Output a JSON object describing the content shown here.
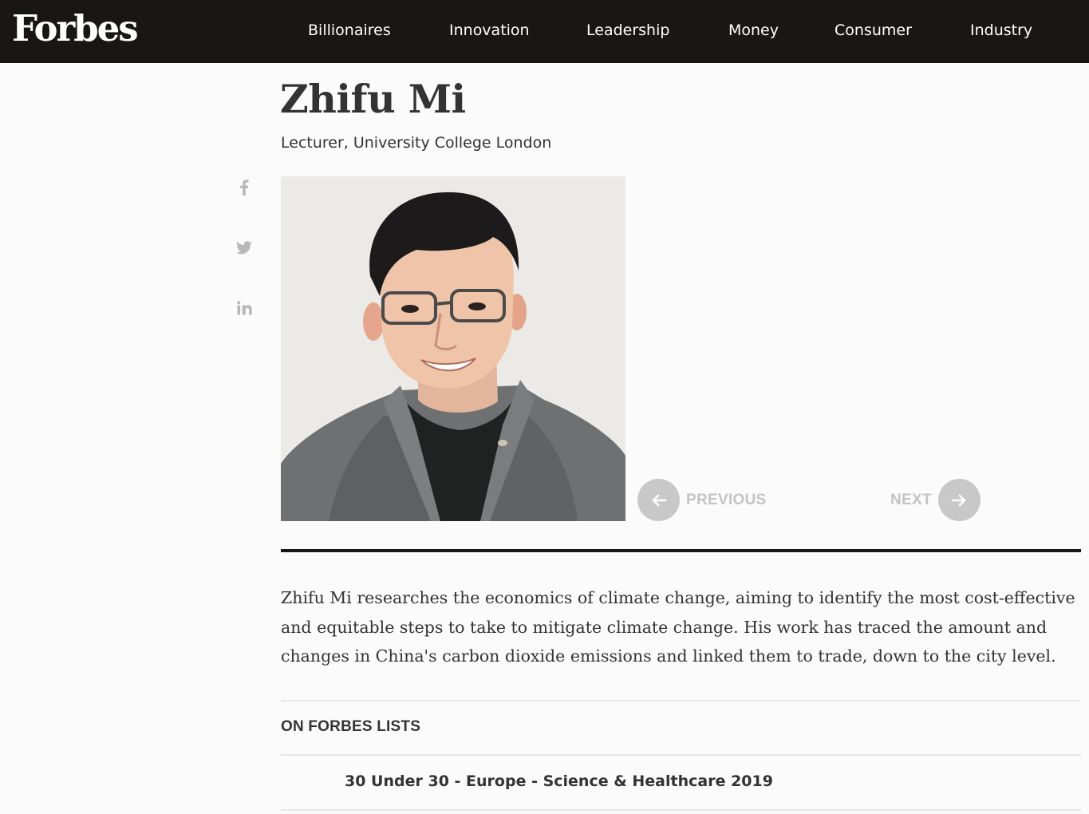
{
  "header": {
    "logo": "Forbes",
    "nav": [
      "Billionaires",
      "Innovation",
      "Leadership",
      "Money",
      "Consumer",
      "Industry"
    ]
  },
  "profile": {
    "name": "Zhifu Mi",
    "title": "Lecturer, University College London",
    "photo_alt": "Zhifu Mi"
  },
  "share": {
    "icons": [
      "facebook-icon",
      "twitter-icon",
      "linkedin-icon"
    ]
  },
  "pager": {
    "previous": "PREVIOUS",
    "next": "NEXT"
  },
  "bio": "Zhifu Mi researches the economics of climate change, aiming to identify the most cost-effective and equitable steps to take to mitigate climate change. His work has traced the amount and changes in China's carbon dioxide emissions and linked them to trade, down to the city level.",
  "lists": {
    "heading": "ON FORBES LISTS",
    "items": [
      "30 Under 30 - Europe - Science & Healthcare 2019"
    ]
  },
  "colors": {
    "header_bg": "#181716",
    "page_bg": "#fbfbfb",
    "text": "#333333",
    "pager_grey": "#c8c8c8"
  }
}
